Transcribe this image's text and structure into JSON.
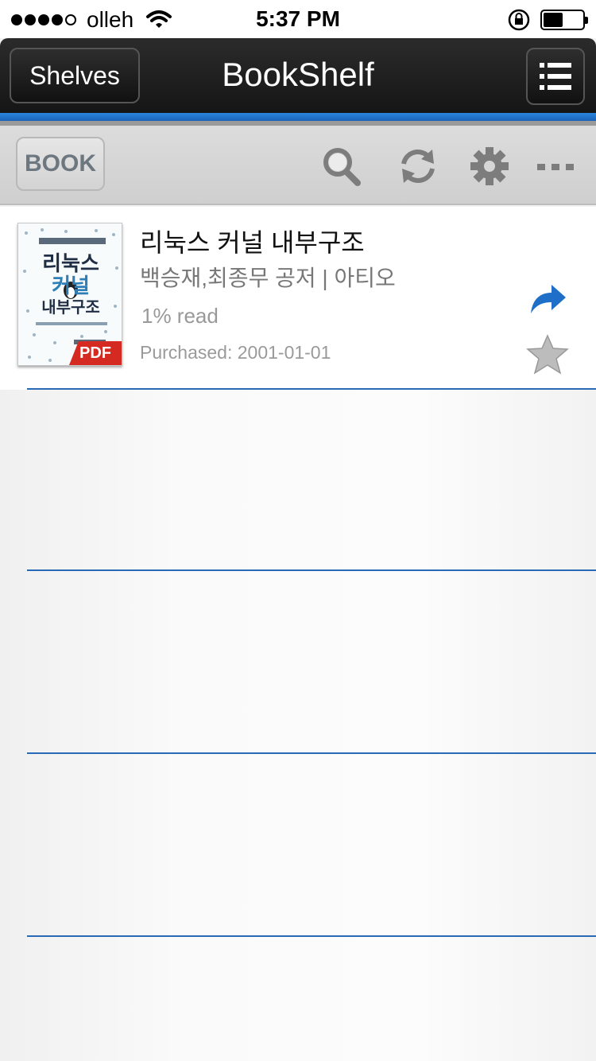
{
  "status_bar": {
    "carrier": "olleh",
    "time": "5:37 PM",
    "signal_bars": 4,
    "signal_total": 5,
    "battery_level": 0.5
  },
  "nav": {
    "shelves_label": "Shelves",
    "title": "BookShelf",
    "accent_color": "#1f74c9"
  },
  "toolbar": {
    "book_label": "BOOK",
    "icons": [
      "search-icon",
      "refresh-icon",
      "gear-icon",
      "more-icon"
    ]
  },
  "books": [
    {
      "title": "리눅스 커널 내부구조",
      "author": "백승재,최종무 공저 | 아티오",
      "progress": "1% read",
      "purchased": "Purchased: 2001-01-01",
      "cover_title_line1": "리눅스",
      "cover_title_line2": "커널",
      "cover_title_line3": "내부구조",
      "format": "PDF"
    }
  ]
}
